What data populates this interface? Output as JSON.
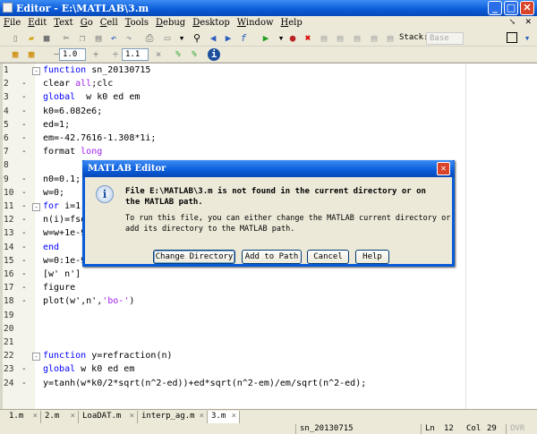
{
  "window": {
    "title": "Editor - E:\\MATLAB\\3.m"
  },
  "menu": [
    "File",
    "Edit",
    "Text",
    "Go",
    "Cell",
    "Tools",
    "Debug",
    "Desktop",
    "Window",
    "Help"
  ],
  "toolbar": {
    "stack_label": "Stack:",
    "stack_value": "Base"
  },
  "cell_toolbar": {
    "decrement_value": "1.0",
    "increment_value": "1.1",
    "minus": "−",
    "plus": "+",
    "divide": "÷",
    "times": "×"
  },
  "code_lines": [
    {
      "n": "1",
      "dash": "",
      "fold": "-",
      "html": "<span class='kw'>function</span> sn_20130715"
    },
    {
      "n": "2",
      "dash": "-",
      "html": "clear <span class='str'>all</span>;clc"
    },
    {
      "n": "3",
      "dash": "-",
      "html": "<span class='kw'>global</span>  w k0 ed em"
    },
    {
      "n": "4",
      "dash": "-",
      "html": "k0=6.082e6;"
    },
    {
      "n": "5",
      "dash": "-",
      "html": "ed=1;"
    },
    {
      "n": "6",
      "dash": "-",
      "html": "em=-42.7616-1.308*1i;"
    },
    {
      "n": "7",
      "dash": "-",
      "html": "format <span class='str'>long</span>"
    },
    {
      "n": "8",
      "dash": "",
      "html": ""
    },
    {
      "n": "9",
      "dash": "-",
      "html": "n0=0.1;"
    },
    {
      "n": "10",
      "dash": "-",
      "html": "w=0;"
    },
    {
      "n": "11",
      "dash": "-",
      "fold": "-",
      "html": "<span class='kw'>for</span> i=1:"
    },
    {
      "n": "12",
      "dash": "-",
      "html": "n(i)=fso"
    },
    {
      "n": "13",
      "dash": "-",
      "html": "w=w+1e-9"
    },
    {
      "n": "14",
      "dash": "-",
      "html": "<span class='kw'>end</span>"
    },
    {
      "n": "15",
      "dash": "-",
      "html": "w=0:1e-9"
    },
    {
      "n": "16",
      "dash": "-",
      "html": "[w' n']"
    },
    {
      "n": "17",
      "dash": "-",
      "html": "figure"
    },
    {
      "n": "18",
      "dash": "-",
      "html": "plot(w',n',<span class='str'>'bo-'</span>)"
    },
    {
      "n": "19",
      "dash": "",
      "html": ""
    },
    {
      "n": "20",
      "dash": "",
      "html": ""
    },
    {
      "n": "21",
      "dash": "",
      "html": ""
    },
    {
      "n": "22",
      "dash": "",
      "fold": "-",
      "html": "<span class='kw'>function</span> y=refraction(n)"
    },
    {
      "n": "23",
      "dash": "-",
      "html": "<span class='kw'>global</span> w k0 ed em"
    },
    {
      "n": "24",
      "dash": "-",
      "html": "y=tanh(w*k0/2*sqrt(n^2-ed))+ed*sqrt(n^2-em)/em/sqrt(n^2-ed);"
    }
  ],
  "tabs": [
    {
      "label": "1.m"
    },
    {
      "label": "2.m"
    },
    {
      "label": "LoaDAT.m"
    },
    {
      "label": "interp_ag.m"
    },
    {
      "label": "3.m",
      "active": true
    }
  ],
  "status": {
    "function": "sn_20130715",
    "ln_label": "Ln",
    "ln": "12",
    "col_label": "Col",
    "col": "29",
    "mode": "OVR"
  },
  "dialog": {
    "title": "MATLAB Editor",
    "message": "File E:\\MATLAB\\3.m is not found in the current directory or on the MATLAB path.",
    "detail": "To run this file, you can either change the MATLAB current directory or add its directory to the MATLAB path.",
    "buttons": [
      "Change Directory",
      "Add to Path",
      "Cancel",
      "Help"
    ]
  }
}
